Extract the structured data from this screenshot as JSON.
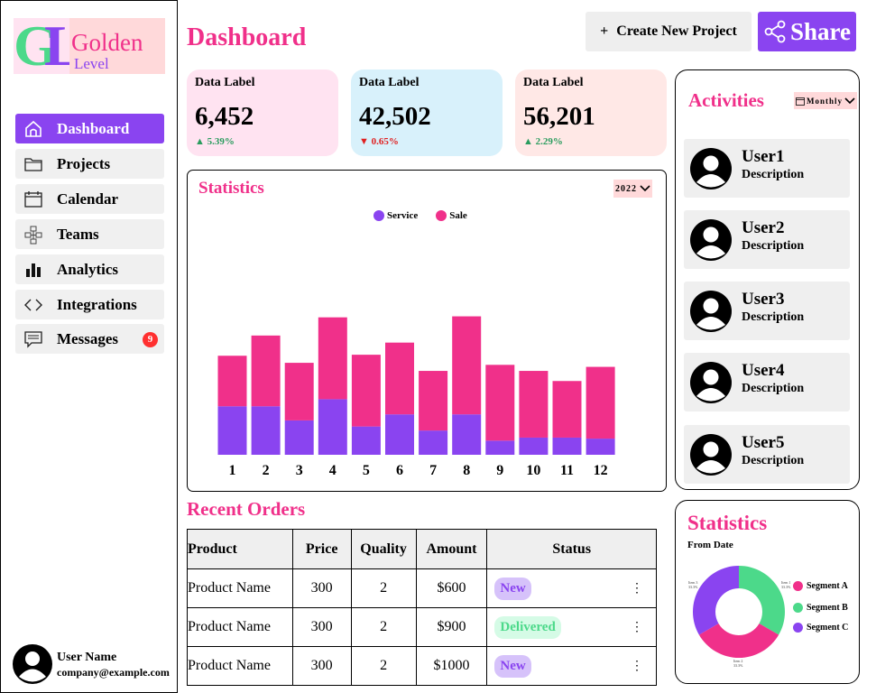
{
  "brand": {
    "mark_g": "G",
    "mark_l": "L",
    "word1": "Golden",
    "word2": "Level"
  },
  "colors": {
    "pink": "#f0308a",
    "purple": "#8a44f0",
    "green": "#4cd98a",
    "service": "#8a44f0",
    "sale": "#f0308a"
  },
  "sidebar": {
    "items": [
      {
        "label": "Dashboard",
        "icon": "home-icon",
        "active": true
      },
      {
        "label": "Projects",
        "icon": "folder-icon"
      },
      {
        "label": "Calendar",
        "icon": "calendar-icon"
      },
      {
        "label": "Teams",
        "icon": "teams-icon"
      },
      {
        "label": "Analytics",
        "icon": "analytics-icon"
      },
      {
        "label": "Integrations",
        "icon": "code-icon"
      },
      {
        "label": "Messages",
        "icon": "message-icon",
        "badge": "9"
      }
    ],
    "user": {
      "name": "User Name",
      "email": "company@example.com"
    }
  },
  "header": {
    "title": "Dashboard",
    "create_label": "Create New Project",
    "share_label": "Share"
  },
  "cards": [
    {
      "label": "Data Label",
      "value": "6,452",
      "change": "5.39%",
      "direction": "up",
      "bg": "#ffe3f1"
    },
    {
      "label": "Data Label",
      "value": "42,502",
      "change": "0.65%",
      "direction": "down",
      "bg": "#d8f1fb"
    },
    {
      "label": "Data Label",
      "value": "56,201",
      "change": "2.29%",
      "direction": "up",
      "bg": "#ffe8e6"
    }
  ],
  "statistics": {
    "title": "Statistics",
    "year": "2022",
    "legend": [
      "Service",
      "Sale"
    ]
  },
  "chart_data": [
    {
      "type": "bar",
      "stacked": true,
      "categories": [
        "1",
        "2",
        "3",
        "4",
        "5",
        "6",
        "7",
        "8",
        "9",
        "10",
        "11",
        "12"
      ],
      "series": [
        {
          "name": "Service",
          "values": [
            48,
            48,
            34,
            55,
            28,
            40,
            24,
            40,
            14,
            17,
            17,
            16
          ]
        },
        {
          "name": "Sale",
          "values": [
            50,
            70,
            57,
            81,
            71,
            71,
            59,
            97,
            75,
            66,
            56,
            71
          ]
        }
      ],
      "legend": "top",
      "grid": false
    },
    {
      "type": "pie",
      "donut": true,
      "title": "Statistics",
      "subtitle": "From Date",
      "labels": [
        "Segment A",
        "Segment B",
        "Segment C"
      ],
      "values": [
        33.3,
        33.3,
        33.3
      ]
    }
  ],
  "orders": {
    "title": "Recent Orders",
    "columns": [
      "Product",
      "Price",
      "Quality",
      "Amount",
      "Status"
    ],
    "rows": [
      {
        "product": "Product Name",
        "price": "300",
        "quality": "2",
        "amount": "$600",
        "status": "New"
      },
      {
        "product": "Product Name",
        "price": "300",
        "quality": "2",
        "amount": "$900",
        "status": "Delivered"
      },
      {
        "product": "Product Name",
        "price": "300",
        "quality": "2",
        "amount": "$1000",
        "status": "New"
      }
    ],
    "menu_glyph": "⋮"
  },
  "activities": {
    "title": "Activities",
    "period": "Monthly",
    "items": [
      {
        "name": "User1",
        "desc": "Description"
      },
      {
        "name": "User2",
        "desc": "Description"
      },
      {
        "name": "User3",
        "desc": "Description"
      },
      {
        "name": "User4",
        "desc": "Description"
      },
      {
        "name": "User5",
        "desc": "Description"
      }
    ]
  },
  "donut": {
    "title": "Statistics",
    "subtitle": "From Date",
    "segments": [
      {
        "name": "Segment A",
        "color": "#f0308a",
        "tag": "Item 1",
        "pct": "33.3%"
      },
      {
        "name": "Segment B",
        "color": "#4cd98a",
        "tag": "Item 2",
        "pct": "33.3%"
      },
      {
        "name": "Segment C",
        "color": "#8a44f0",
        "tag": "Item 3",
        "pct": "33.3%"
      }
    ]
  }
}
